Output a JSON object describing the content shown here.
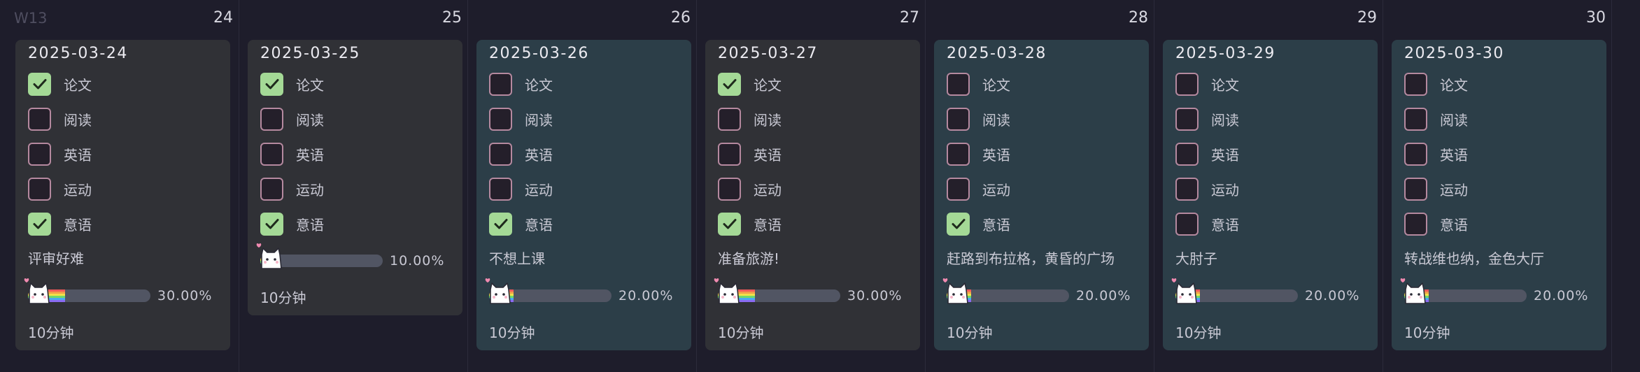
{
  "week_label": "W13",
  "task_names": [
    "论文",
    "阅读",
    "英语",
    "运动",
    "意语"
  ],
  "checked_color": "#a4d996",
  "days": [
    {
      "num": "24",
      "date": "2025-03-24",
      "style": "gray",
      "checks": [
        true,
        false,
        false,
        false,
        true
      ],
      "note": "评审好难",
      "progress": 0.3,
      "progress_label": "30.00%",
      "time": "10分钟"
    },
    {
      "num": "25",
      "date": "2025-03-25",
      "style": "gray",
      "checks": [
        true,
        false,
        false,
        false,
        true
      ],
      "note": "",
      "progress": 0.1,
      "progress_label": "10.00%",
      "time": "10分钟"
    },
    {
      "num": "26",
      "date": "2025-03-26",
      "style": "teal",
      "checks": [
        false,
        false,
        false,
        false,
        true
      ],
      "note": "不想上课",
      "progress": 0.2,
      "progress_label": "20.00%",
      "time": "10分钟"
    },
    {
      "num": "27",
      "date": "2025-03-27",
      "style": "gray",
      "checks": [
        true,
        false,
        false,
        false,
        true
      ],
      "note": "准备旅游!",
      "progress": 0.3,
      "progress_label": "30.00%",
      "time": "10分钟"
    },
    {
      "num": "28",
      "date": "2025-03-28",
      "style": "teal",
      "checks": [
        false,
        false,
        false,
        false,
        true
      ],
      "note": "赶路到布拉格，黄昏的广场",
      "progress": 0.2,
      "progress_label": "20.00%",
      "time": "10分钟"
    },
    {
      "num": "29",
      "date": "2025-03-29",
      "style": "teal",
      "checks": [
        false,
        false,
        false,
        false,
        false
      ],
      "note": "大肘子",
      "progress": 0.2,
      "progress_label": "20.00%",
      "time": "10分钟"
    },
    {
      "num": "30",
      "date": "2025-03-30",
      "style": "teal",
      "checks": [
        false,
        false,
        false,
        false,
        false
      ],
      "note": "转战维也纳，金色大厅",
      "progress": 0.2,
      "progress_label": "20.00%",
      "time": "10分钟"
    }
  ]
}
